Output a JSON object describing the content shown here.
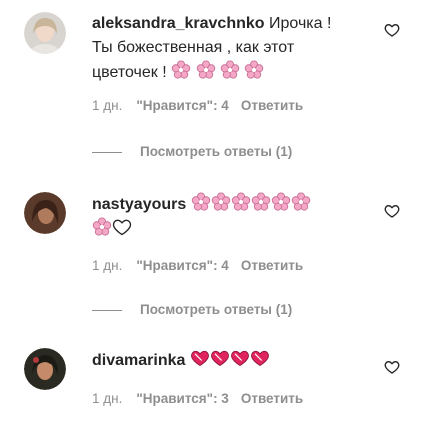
{
  "comments": [
    {
      "username": "aleksandra_kravchnko",
      "text_line1": " Ирочка !",
      "text_line2": "Ты божественная , как этот",
      "text_line3": "цветочек ! ",
      "emoji": "cherry-blossom",
      "time": "1 дн.",
      "likes": "\"Нравится\": 4",
      "reply": "Ответить",
      "view_replies": "Посмотреть ответы (1)"
    },
    {
      "username": "nastyayours",
      "emoji": "cherry-blossom",
      "time": "1 дн.",
      "likes": "\"Нравится\": 4",
      "reply": "Ответить",
      "view_replies": "Посмотреть ответы (1)"
    },
    {
      "username": "divamarinka",
      "emoji": "heart",
      "time": "1 дн.",
      "likes": "\"Нравится\": 3",
      "reply": "Ответить"
    }
  ],
  "colors": {
    "text": "#262626",
    "secondary": "#8e8e8e",
    "blossom": "#f4a7c6",
    "heart": "#e0245e"
  },
  "icons": {
    "like": "heart-outline-icon"
  }
}
